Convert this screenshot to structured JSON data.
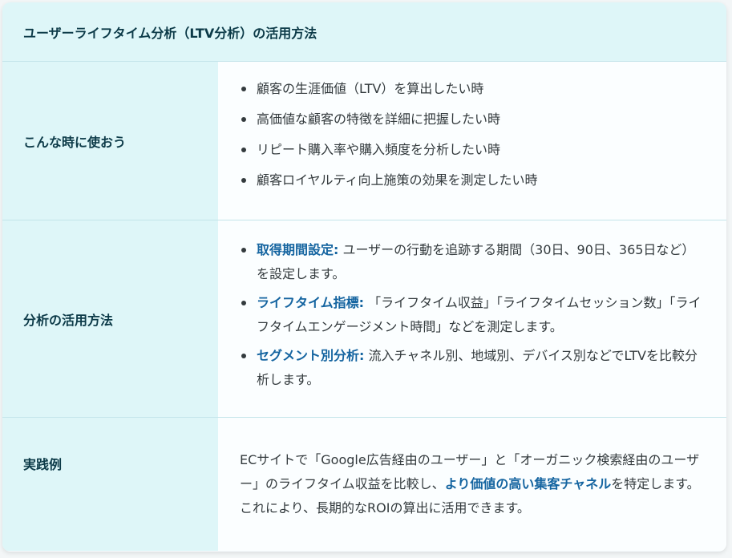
{
  "header": {
    "title": "ユーザーライフタイム分析（LTV分析）の活用方法"
  },
  "rows": [
    {
      "label": "こんな時に使おう",
      "items": [
        "顧客の生涯価値（LTV）を算出したい時",
        "高価値な顧客の特徴を詳細に把握したい時",
        "リピート購入率や購入頻度を分析したい時",
        "顧客ロイヤルティ向上施策の効果を測定したい時"
      ]
    },
    {
      "label": "分析の活用方法",
      "items": [
        {
          "term": "取得期間設定:",
          "text": " ユーザーの行動を追跡する期間（30日、90日、365日など）を設定します。"
        },
        {
          "term": "ライフタイム指標:",
          "text": " 「ライフタイム収益」「ライフタイムセッション数」「ライフタイムエンゲージメント時間」などを測定します。"
        },
        {
          "term": "セグメント別分析:",
          "text": " 流入チャネル別、地域別、デバイス別などでLTVを比較分析します。"
        }
      ]
    },
    {
      "label": "実践例",
      "text_before": "ECサイトで「Google広告経由のユーザー」と「オーガニック検索経由のユーザー」のライフタイム収益を比較し、",
      "highlight": "より価値の高い集客チャネル",
      "text_after": "を特定します。これにより、長期的なROIの算出に活用できます。"
    }
  ],
  "colors": {
    "header_bg": "#def6f8",
    "label_bg": "#def6f8",
    "content_bg": "#fbfeff",
    "heading_text": "#0c3a48",
    "body_text": "#333a3d",
    "accent": "#1464a0",
    "divider": "#c3e4ea"
  }
}
